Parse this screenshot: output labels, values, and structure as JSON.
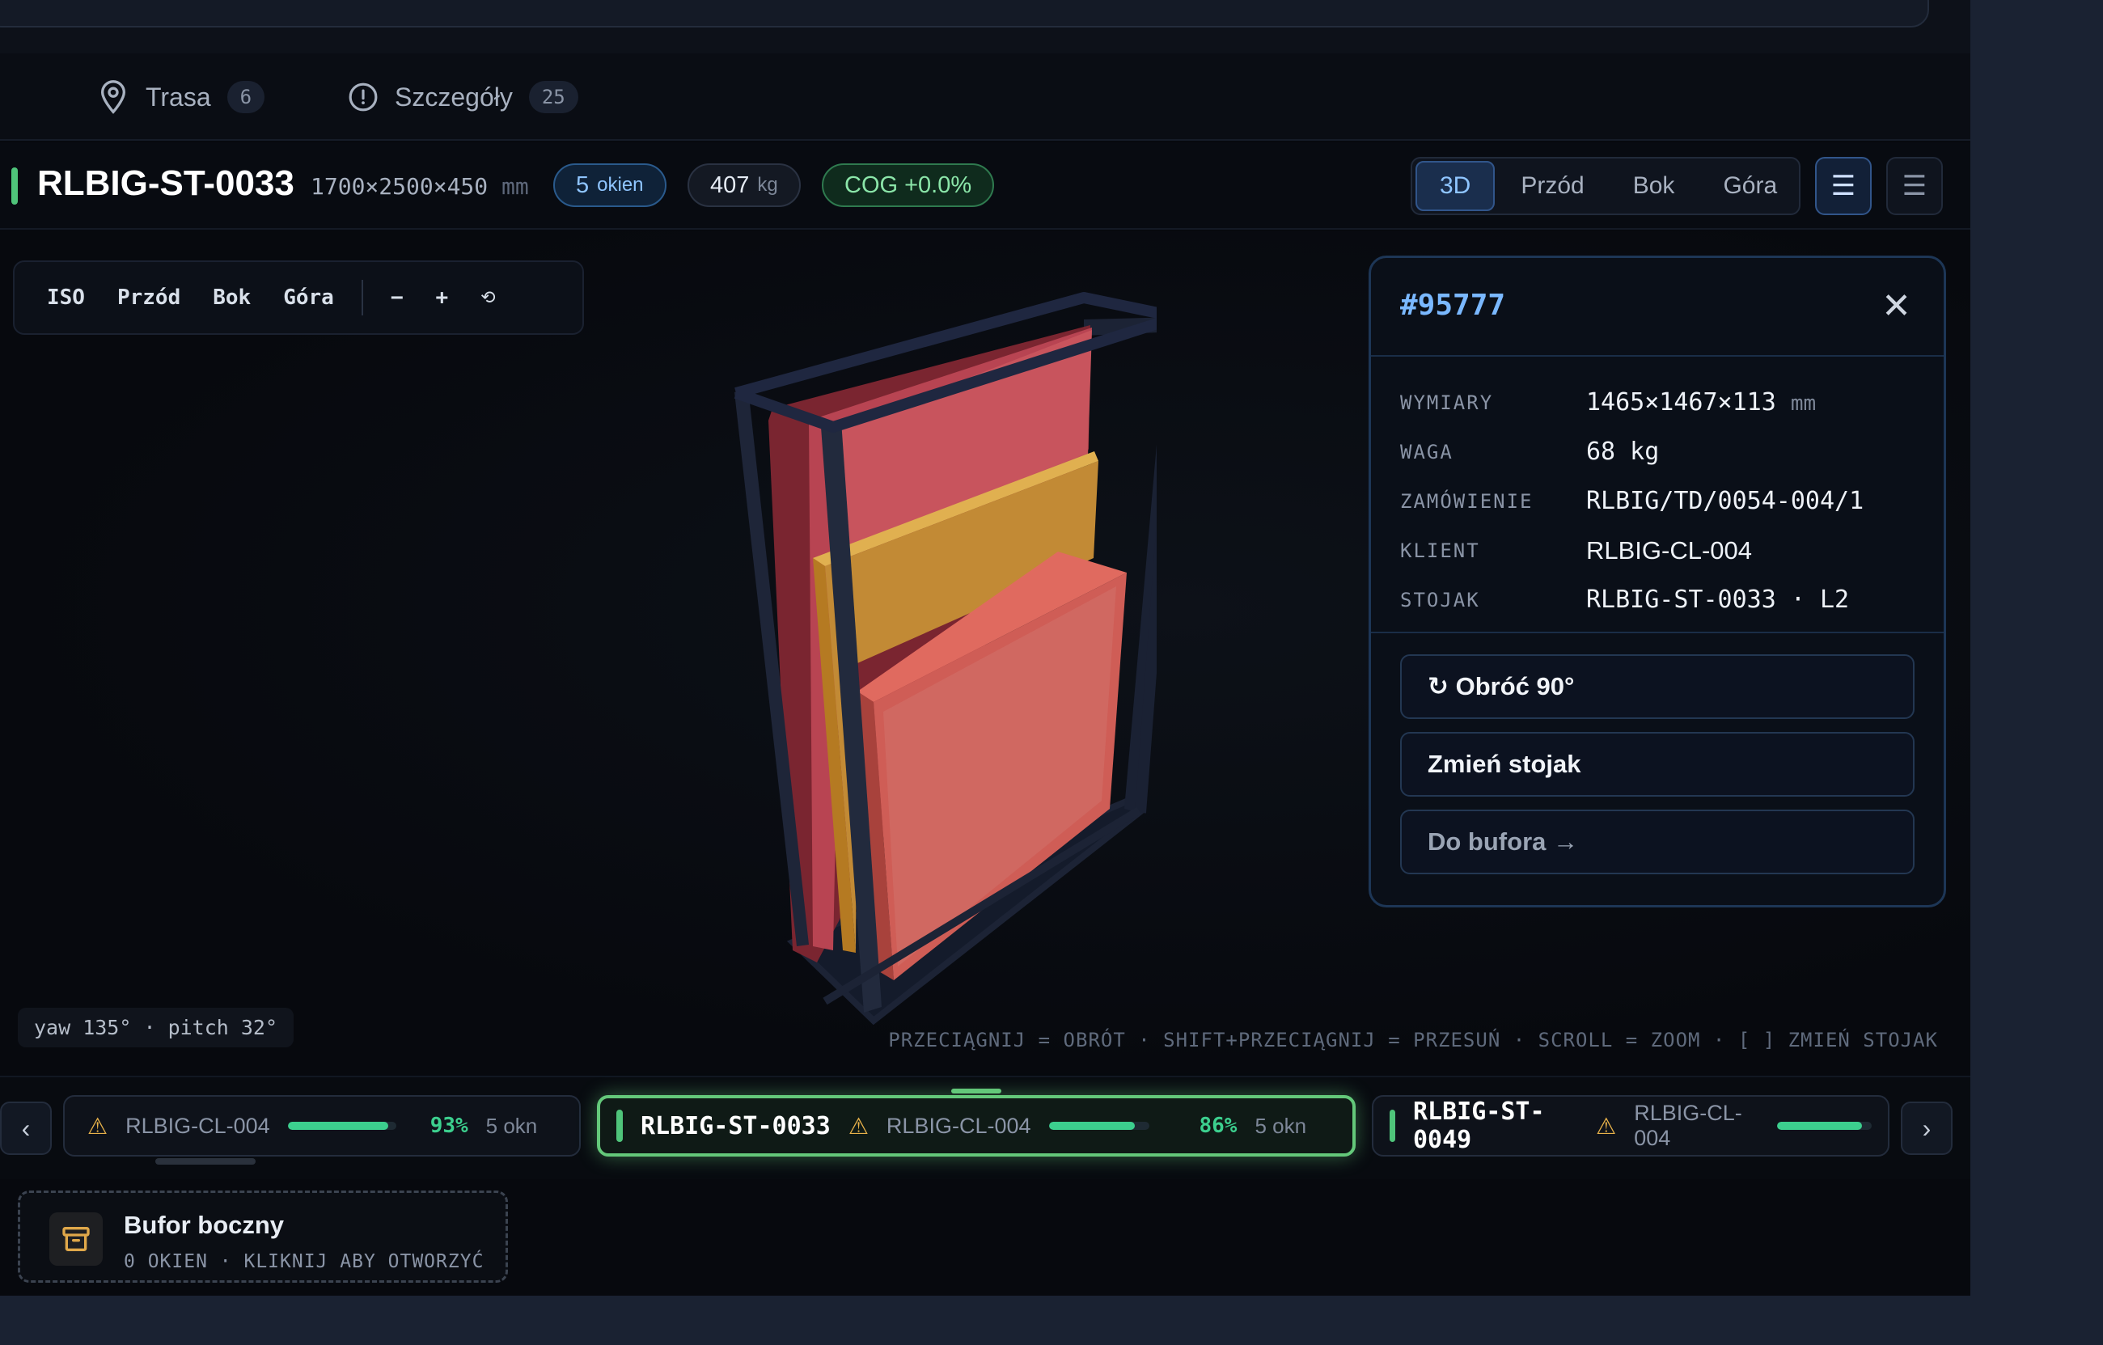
{
  "tabs": [
    {
      "label": "Trasa",
      "count": "6",
      "icon": "map-pin-icon"
    },
    {
      "label": "Szczegóły",
      "count": "25",
      "icon": "info-circle-icon"
    }
  ],
  "tab_partial_count": "0",
  "rack": {
    "title": "RLBIG-ST-0033",
    "dims": "1700×2500×450",
    "dims_unit": "mm",
    "windows_value": "5",
    "windows_label": "okien",
    "weight_value": "407",
    "weight_unit": "kg",
    "cog": "COG +0.0%"
  },
  "view_modes": [
    "3D",
    "Przód",
    "Bok",
    "Góra"
  ],
  "view_active": "3D",
  "camera": {
    "buttons": [
      "ISO",
      "Przód",
      "Bok",
      "Góra"
    ],
    "zoom_out": "−",
    "zoom_in": "+",
    "reset": "⟲",
    "readout": "yaw 135° · pitch 32°",
    "hint": "PRZECIĄGNIJ = OBRÓT · SHIFT+PRZECIĄGNIJ = PRZESUŃ · SCROLL = ZOOM · [ ] ZMIEŃ STOJAK"
  },
  "detail": {
    "id": "#95777",
    "close": "✕",
    "rows": [
      {
        "key": "WYMIARY",
        "value": "1465×1467×113",
        "unit": "mm"
      },
      {
        "key": "WAGA",
        "value": "68 kg",
        "unit": ""
      },
      {
        "key": "ZAMÓWIENIE",
        "value": "RLBIG/TD/0054-004/1",
        "unit": ""
      },
      {
        "key": "KLIENT",
        "value": "RLBIG-CL-004",
        "unit": ""
      },
      {
        "key": "STOJAK",
        "value": "RLBIG-ST-0033 · L2",
        "unit": ""
      }
    ],
    "actions": {
      "rotate": "↻ Obróć 90°",
      "change_rack": "Zmień stojak",
      "to_buffer": "Do bufora →"
    }
  },
  "carousel": {
    "prev": "‹",
    "next": "›",
    "cards": [
      {
        "title": "",
        "client": "RLBIG-CL-004",
        "fill": 0.93,
        "pct": "93%",
        "count": "5 okn"
      },
      {
        "title": "RLBIG-ST-0033",
        "client": "RLBIG-CL-004",
        "fill": 0.86,
        "pct": "86%",
        "count": "5 okn"
      },
      {
        "title": "RLBIG-ST-0049",
        "client": "RLBIG-CL-004",
        "fill": 0.9,
        "pct": "",
        "count": ""
      }
    ],
    "warn_symbol": "⚠"
  },
  "buffer": {
    "title": "Bufor boczny",
    "subtitle": "0 OKIEN · KLIKNIJ ABY OTWORZYĆ"
  },
  "colors": {
    "accent_green": "#4fc47a",
    "accent_blue": "#7ab8ff",
    "progress": "#3ccf8e",
    "warning": "#e8b24a",
    "pane_red": "#c8555e",
    "pane_amber": "#d49a3a",
    "pane_salmon": "#d9645c",
    "frame": "#1c2335"
  }
}
